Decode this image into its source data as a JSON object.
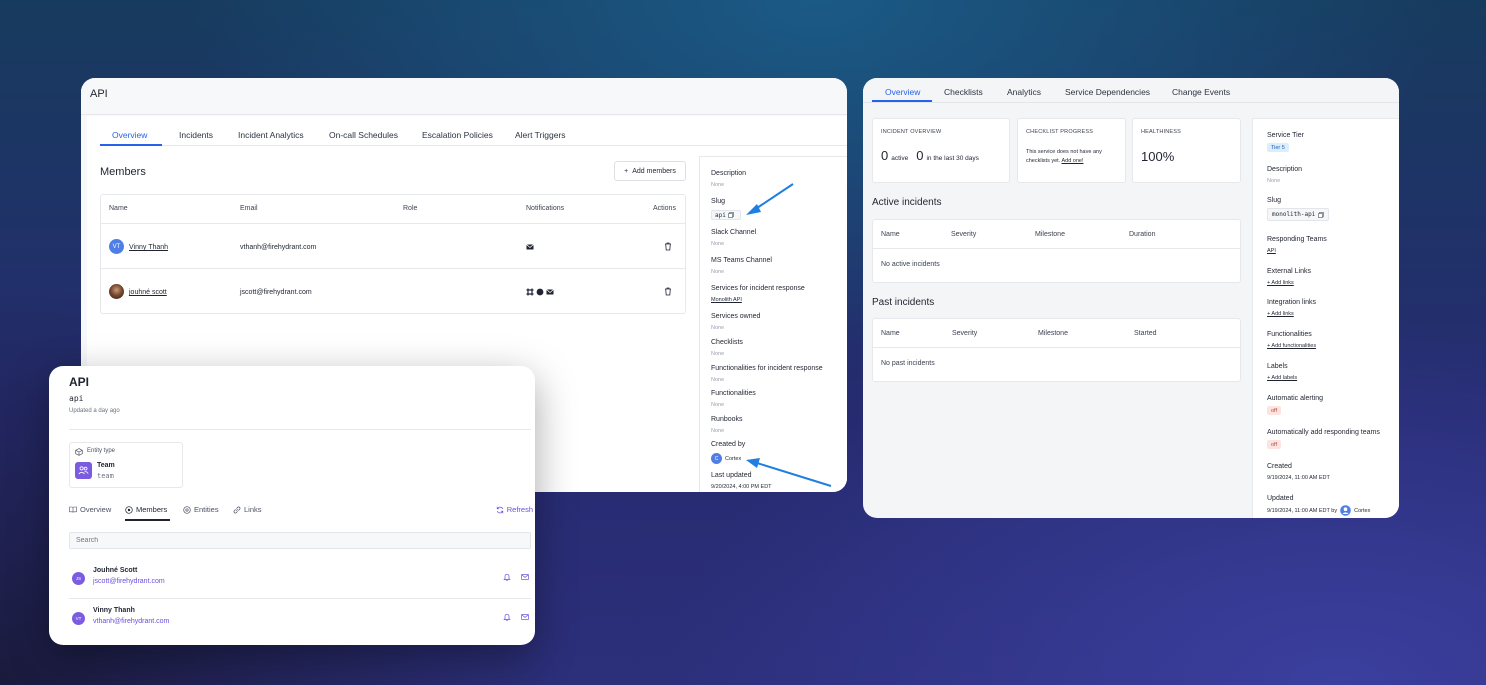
{
  "cardA": {
    "title": "API",
    "tabs": [
      "Overview",
      "Incidents",
      "Incident Analytics",
      "On-call Schedules",
      "Escalation Policies",
      "Alert Triggers"
    ],
    "members_title": "Members",
    "add_members_label": "Add members",
    "table_headers": [
      "Name",
      "Email",
      "Role",
      "Notifications",
      "Actions"
    ],
    "members": [
      {
        "initials": "VT",
        "name": "Vinny Thanh",
        "email": "vthanh@firehydrant.com"
      },
      {
        "initials": "",
        "name": "jouhné scott",
        "email": "jscott@firehydrant.com"
      }
    ],
    "side": {
      "description_label": "Description",
      "description_value": "None",
      "slug_label": "Slug",
      "slug_value": "api",
      "slack_label": "Slack Channel",
      "slack_value": "None",
      "teams_label": "MS Teams Channel",
      "teams_value": "None",
      "services_response_label": "Services for incident response",
      "services_response_value": "Monolith API",
      "services_owned_label": "Services owned",
      "services_owned_value": "None",
      "checklists_label": "Checklists",
      "checklists_value": "None",
      "func_response_label": "Functionalities for incident response",
      "func_response_value": "None",
      "functionalities_label": "Functionalities",
      "functionalities_value": "None",
      "runbooks_label": "Runbooks",
      "runbooks_value": "None",
      "created_label": "Created by",
      "created_initial": "C",
      "created_value": "Cortex",
      "updated_label": "Last updated",
      "updated_value": "9/20/2024, 4:00 PM EDT"
    }
  },
  "cardB": {
    "tabs": [
      "Overview",
      "Checklists",
      "Analytics",
      "Service Dependencies",
      "Change Events"
    ],
    "incident_overview": {
      "title": "INCIDENT OVERVIEW",
      "active_count": "0",
      "active_label": "active",
      "last30_count": "0",
      "last30_label": "in the last 30 days"
    },
    "checklist_progress": {
      "title": "CHECKLIST PROGRESS",
      "text": "This service does not have any checklists yet.",
      "link": "Add one!"
    },
    "healthiness": {
      "title": "HEALTHINESS",
      "value": "100%"
    },
    "active_incidents": {
      "title": "Active incidents",
      "headers": [
        "Name",
        "Severity",
        "Milestone",
        "Duration"
      ],
      "empty": "No active incidents"
    },
    "past_incidents": {
      "title": "Past incidents",
      "headers": [
        "Name",
        "Severity",
        "Milestone",
        "Started"
      ],
      "empty": "No past incidents"
    },
    "side": {
      "tier_label": "Service Tier",
      "tier_value": "Tier 5",
      "description_label": "Description",
      "description_value": "None",
      "slug_label": "Slug",
      "slug_value": "monolith-api",
      "responding_label": "Responding Teams",
      "responding_value": "API",
      "external_label": "External Links",
      "external_value": "+ Add links",
      "integration_label": "Integration links",
      "integration_value": "+ Add links",
      "functionalities_label": "Functionalities",
      "functionalities_value": "+ Add functionalities",
      "labels_label": "Labels",
      "labels_value": "+ Add labels",
      "auto_alert_label": "Automatic alerting",
      "auto_alert_value": "off",
      "auto_add_label": "Automatically add responding teams",
      "auto_add_value": "off",
      "created_label": "Created",
      "created_value": "9/19/2024, 11:00 AM EDT",
      "updated_label": "Updated",
      "updated_value": "9/19/2024, 11:00 AM EDT by",
      "updated_by": "Cortex"
    }
  },
  "cardC": {
    "title": "API",
    "slug": "api",
    "updated": "Updated a day ago",
    "entity_type_label": "Entity type",
    "team_name": "Team",
    "team_slug": "team",
    "tabs": [
      "Overview",
      "Members",
      "Entities",
      "Links"
    ],
    "refresh_label": "Refresh",
    "search_placeholder": "Search",
    "members": [
      {
        "initials": "JS",
        "name": "Jouhné Scott",
        "email": "jscott@firehydrant.com"
      },
      {
        "initials": "VT",
        "name": "Vinny Thanh",
        "email": "vthanh@firehydrant.com"
      }
    ]
  },
  "colors": {
    "accent_blue": "#2563eb",
    "accent_purple": "#6b4ee0",
    "arrow_blue": "#1e7fe0"
  }
}
